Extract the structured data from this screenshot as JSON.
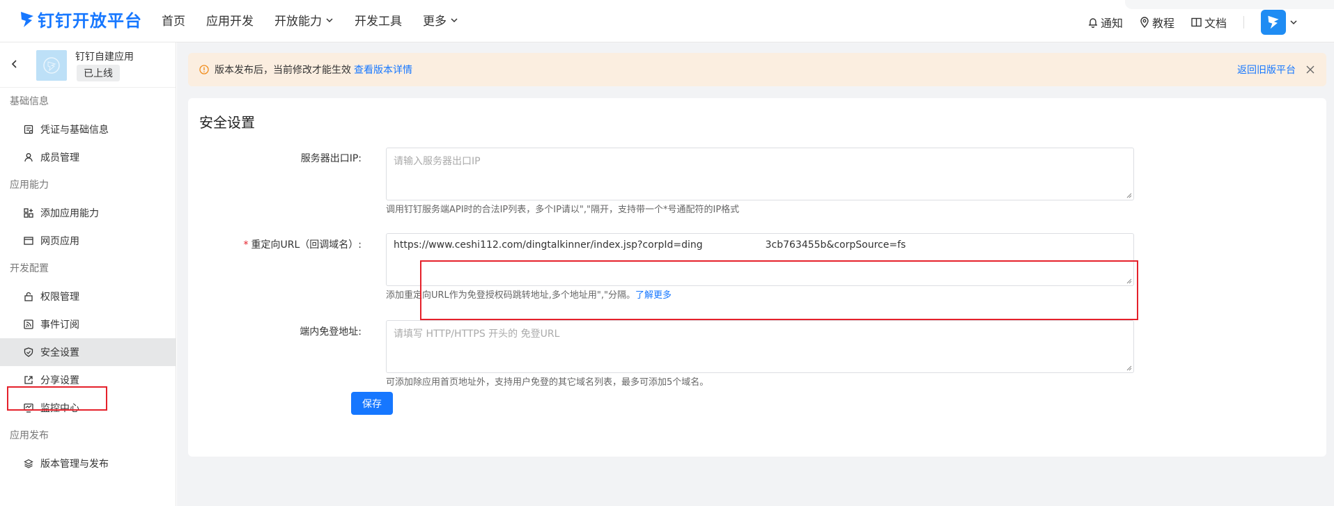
{
  "brand": {
    "logo_text": "钉钉开放平台"
  },
  "nav": {
    "items": [
      "首页",
      "应用开发",
      "开放能力",
      "开发工具",
      "更多"
    ]
  },
  "top_right": {
    "notify": "通知",
    "tutorial": "教程",
    "docs": "文档"
  },
  "app": {
    "name": "钉钉自建应用",
    "status": "已上线"
  },
  "sidebar": {
    "sections": [
      {
        "title": "基础信息",
        "items": [
          "凭证与基础信息",
          "成员管理"
        ]
      },
      {
        "title": "应用能力",
        "items": [
          "添加应用能力",
          "网页应用"
        ]
      },
      {
        "title": "开发配置",
        "items": [
          "权限管理",
          "事件订阅",
          "安全设置",
          "分享设置",
          "监控中心"
        ]
      },
      {
        "title": "应用发布",
        "items": [
          "版本管理与发布"
        ]
      }
    ],
    "active": "安全设置"
  },
  "notice": {
    "text": "版本发布后，当前修改才能生效",
    "link": "查看版本详情",
    "back_link": "返回旧版平台"
  },
  "form": {
    "title": "安全设置",
    "ip": {
      "label": "服务器出口IP:",
      "placeholder": "请输入服务器出口IP",
      "help": "调用钉钉服务端API时的合法IP列表，多个IP请以\",\"隔开，支持带一个*号通配符的IP格式"
    },
    "redirect": {
      "label": "重定向URL（回调域名）:",
      "value_part1": "https://www.ceshi112.com/dingtalkinner/index.jsp?corpId=ding",
      "value_part2": "3cb763455b&corpSource=fs",
      "help": "添加重定向URL作为免登授权码跳转地址,多个地址用\",\"分隔。",
      "help_link": "了解更多"
    },
    "inapp": {
      "label": "端内免登地址:",
      "placeholder": "请填写 HTTP/HTTPS 开头的 免登URL",
      "help": "可添加除应用首页地址外，支持用户免登的其它域名列表，最多可添加5个域名。"
    },
    "save_label": "保存"
  },
  "colors": {
    "accent": "#1677ff",
    "highlight": "#e5212b",
    "notice_bg": "#fbeee0"
  }
}
